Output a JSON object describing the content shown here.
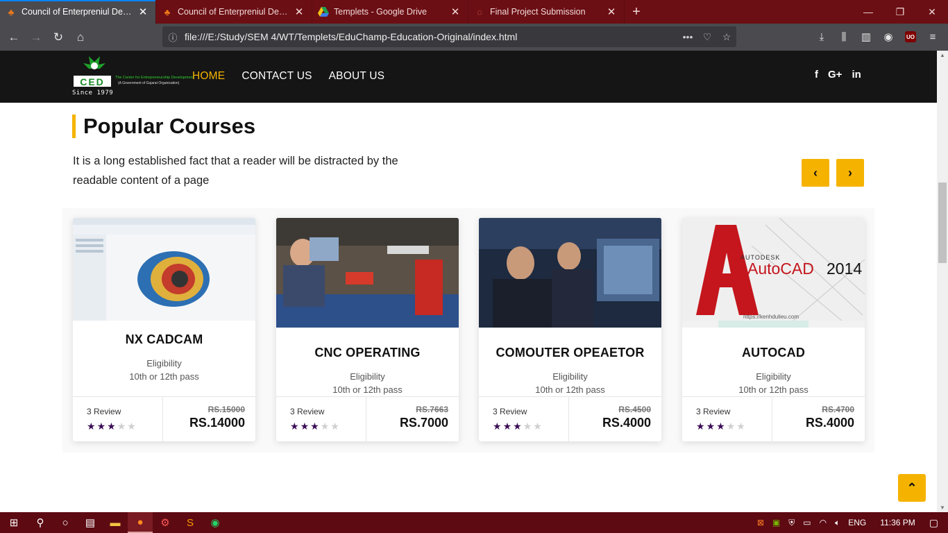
{
  "browser": {
    "tabs": [
      {
        "title": "Council of Enterpreniul Devlopm",
        "active": true
      },
      {
        "title": "Council of Enterpreniul Devlopm",
        "active": false
      },
      {
        "title": "Templets - Google Drive",
        "active": false
      },
      {
        "title": "Final Project Submission",
        "active": false
      }
    ],
    "url": "file:///E:/Study/SEM 4/WT/Templets/EduChamp-Education-Original/index.html",
    "ublock_badge": "UO"
  },
  "site": {
    "logo": {
      "letters": "CED",
      "tagline": "The Center for Entrepreneurship Development",
      "subtag": "(A Government of Gujarat Organization)",
      "since": "Since 1979"
    },
    "menu": [
      {
        "label": "HOME",
        "active": true
      },
      {
        "label": "CONTACT US",
        "active": false
      },
      {
        "label": "ABOUT US",
        "active": false
      }
    ],
    "social": [
      "f",
      "G+",
      "in"
    ]
  },
  "section": {
    "title_bold": "Popular",
    "title_rest": "Courses",
    "intro": "It is a long established fact that a reader will be distracted by the readable content of a page"
  },
  "courses": [
    {
      "name": "NX CADCAM",
      "elig_label": "Eligibility",
      "elig": "10th or 12th pass",
      "reviews": "3 Review",
      "rating": 3,
      "old_price": "RS.15000",
      "price": "RS.14000"
    },
    {
      "name": "CNC OPERATING",
      "elig_label": "Eligibility",
      "elig": "10th or 12th pass",
      "reviews": "3 Review",
      "rating": 3,
      "old_price": "RS.7663",
      "price": "RS.7000"
    },
    {
      "name": "COMOUTER OPEAETOR",
      "elig_label": "Eligibility",
      "elig": "10th or 12th pass",
      "reviews": "3 Review",
      "rating": 3,
      "old_price": "RS.4500",
      "price": "RS.4000"
    },
    {
      "name": "AUTOCAD",
      "elig_label": "Eligibility",
      "elig": "10th or 12th pass",
      "reviews": "3 Review",
      "rating": 3,
      "old_price": "RS.4700",
      "price": "RS.4000"
    }
  ],
  "autocad_image": {
    "brand": "AUTODESK",
    "product": "AutoCAD",
    "year": "2014",
    "site": "https://kenhdulieu.com"
  },
  "taskbar": {
    "lang": "ENG",
    "time": "11:36 PM"
  },
  "colors": {
    "accent": "#f5b300",
    "star": "#3b0d57",
    "header": "#151515",
    "tabbar": "#6b0f14"
  }
}
